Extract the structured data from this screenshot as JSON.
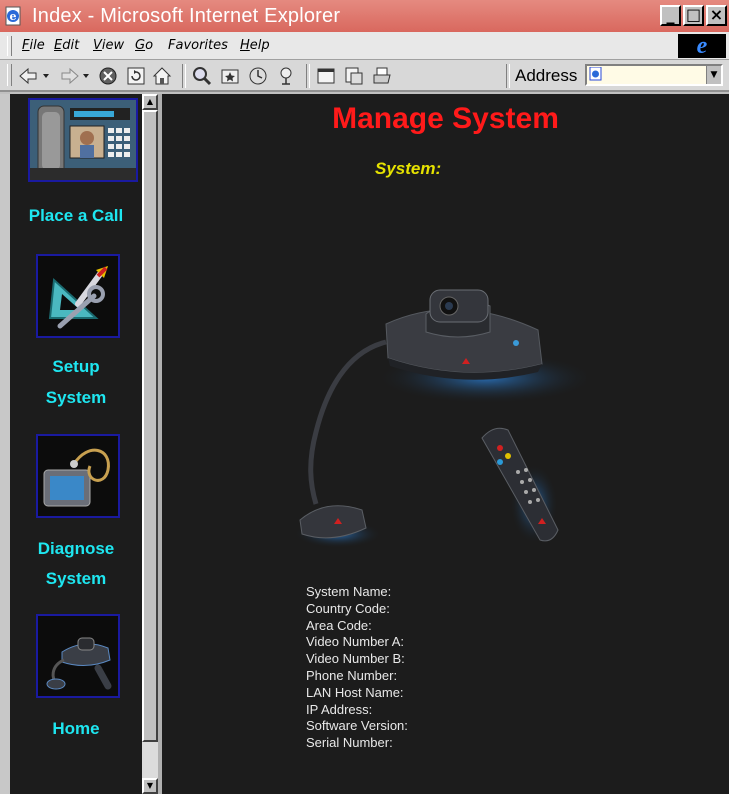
{
  "window": {
    "title": "Index - Microsoft Internet Explorer",
    "controls": {
      "minimize": "_",
      "maximize": "□",
      "close": "×"
    }
  },
  "menu": [
    {
      "accel": "F",
      "rest": "ile"
    },
    {
      "accel": "E",
      "rest": "dit"
    },
    {
      "accel": "V",
      "rest": "iew"
    },
    {
      "accel": "G",
      "rest": "o"
    },
    {
      "accel": "",
      "rest": "Favorites"
    },
    {
      "accel": "H",
      "rest": "elp"
    }
  ],
  "ie_logo": "e",
  "toolbar": {
    "icons": [
      "back-icon",
      "forward-icon",
      "stop-icon",
      "refresh-icon",
      "home-icon",
      "search-icon",
      "favorites-icon",
      "history-icon",
      "channels-icon",
      "fullscreen-icon",
      "mail-icon",
      "print-icon"
    ],
    "address_label": "Address",
    "address_value": ""
  },
  "colors": {
    "frame_background": "#1c1c1c",
    "nav_label": "#1ee6f0",
    "title": "#ff1a1a",
    "system_label": "#e6e200",
    "tile_border": "#1a1aa0",
    "titlebar": "#d9685e"
  },
  "nav": {
    "place_call": "Place a Call",
    "setup_line1": "Setup",
    "setup_line2": "System",
    "diagnose_line1": "Diagnose",
    "diagnose_line2": "System",
    "home": "Home"
  },
  "main": {
    "title": "Manage System",
    "system_label": "System:",
    "info_fields": [
      "System Name:",
      "Country Code:",
      "Area Code:",
      "Video Number A:",
      "Video Number B:",
      "Phone Number:",
      "LAN Host Name:",
      "IP Address:",
      "Software Version:",
      "Serial Number:"
    ]
  }
}
